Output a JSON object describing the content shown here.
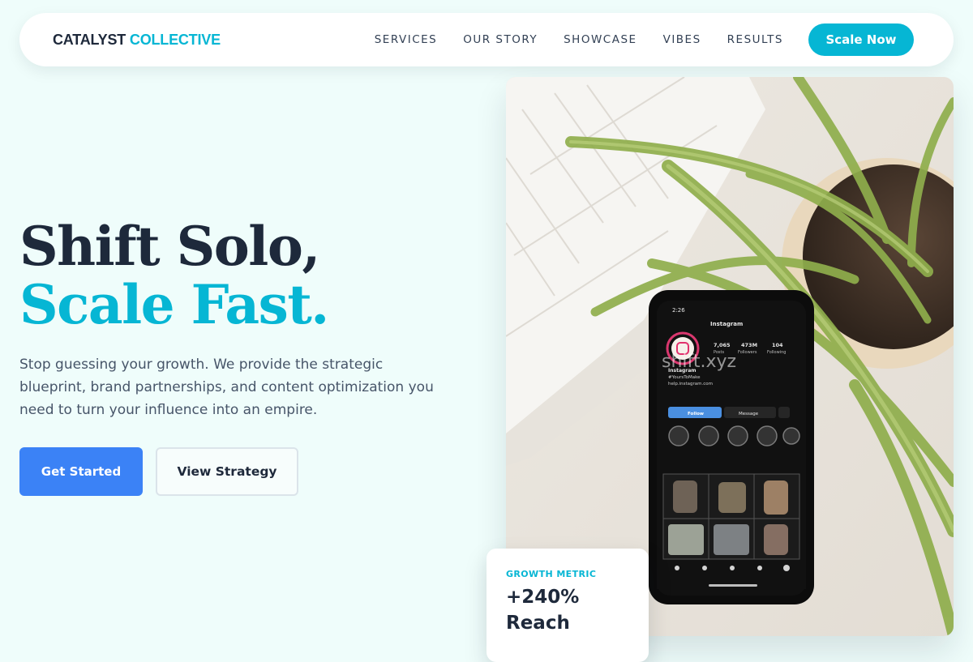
{
  "nav": {
    "brand_part1": "CATALYST",
    "brand_part2": "COLLECTIVE",
    "links": [
      "SERVICES",
      "OUR STORY",
      "SHOWCASE",
      "VIBES",
      "RESULTS"
    ],
    "cta_label": "Scale Now"
  },
  "hero": {
    "title_line1": "Shift Solo,",
    "title_line2": "Scale Fast.",
    "subtitle": "Stop guessing your growth. We provide the strategic blueprint, brand partnerships, and content optimization you need to turn your influence into an empire.",
    "primary_button": "Get Started",
    "secondary_button": "View Strategy"
  },
  "photo": {
    "phone_status_time": "2:26",
    "profile_app": "Instagram",
    "stats": [
      {
        "value": "7,065",
        "label": "Posts"
      },
      {
        "value": "473M",
        "label": "Followers"
      },
      {
        "value": "104",
        "label": "Following"
      }
    ],
    "bio_name": "Instagram",
    "bio_tag": "#YoursToMake",
    "bio_link": "help.instagram.com",
    "follow_label": "Follow",
    "message_label": "Message",
    "watermark": "shift.xyz"
  },
  "metric": {
    "label": "GROWTH METRIC",
    "value": "+240% Reach"
  },
  "colors": {
    "page_bg": "#effdfb",
    "accent_cyan": "#06b6d4",
    "primary_blue": "#3b82f6",
    "dark_text": "#1e293b"
  }
}
